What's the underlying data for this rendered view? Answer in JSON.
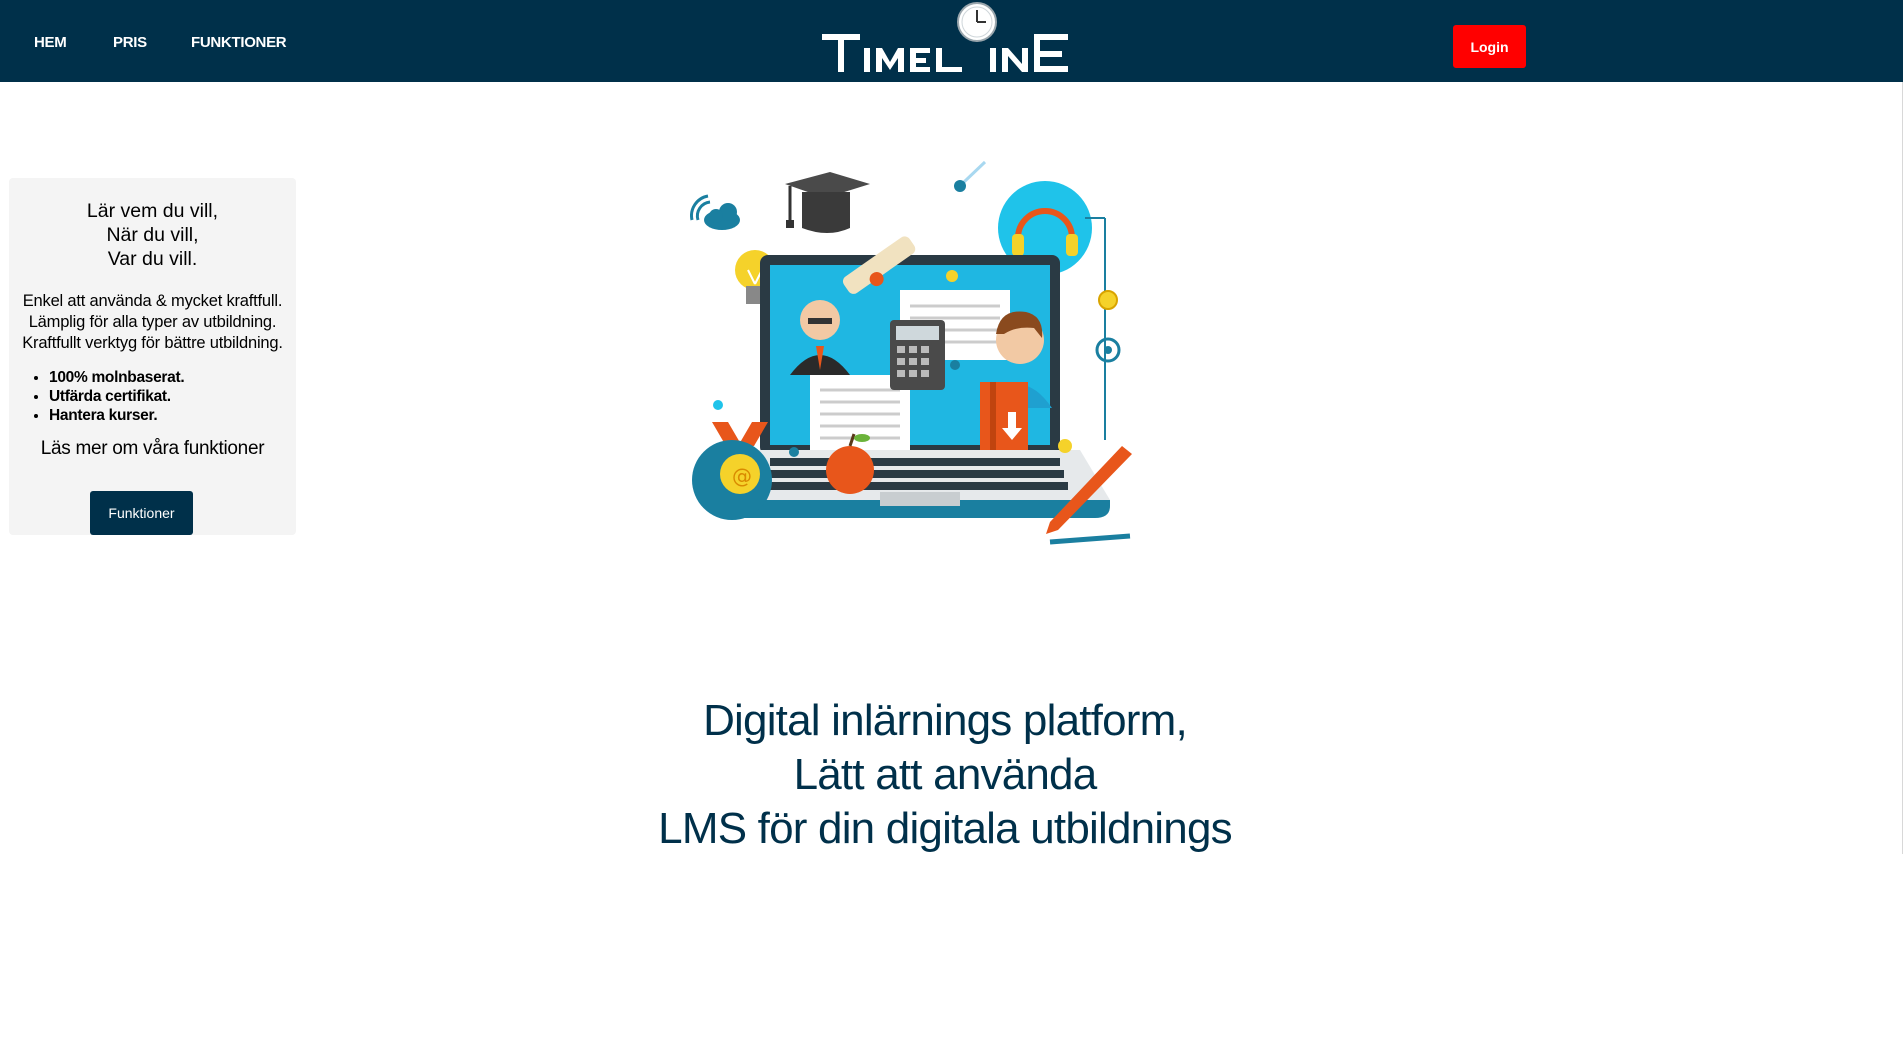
{
  "nav": {
    "items": [
      {
        "label": "HEM"
      },
      {
        "label": "PRIS"
      },
      {
        "label": "FUNKTIONER"
      }
    ],
    "brand": "Timeline",
    "login_label": "Login"
  },
  "card": {
    "heading": [
      "Lär vem du vill,",
      "När du vill,",
      "Var du vill."
    ],
    "description": [
      "Enkel att använda & mycket kraftfull.",
      "Lämplig för alla typer av utbildning.",
      "Kraftfullt verktyg för bättre utbildning."
    ],
    "features": [
      "100% molnbaserat.",
      "Utfärda certifikat.",
      "Hantera kurser."
    ],
    "subheading": "Läs mer om våra funktioner",
    "button_label": "Funktioner"
  },
  "hero": {
    "lines": [
      "Digital inlärnings platform,",
      "Lätt att använda",
      "LMS för din digitala utbildnings"
    ]
  },
  "colors": {
    "navbar": "#00304a",
    "login_button": "#ff0000",
    "card_background": "#f4f4f4",
    "hero_text": "#00304a"
  }
}
